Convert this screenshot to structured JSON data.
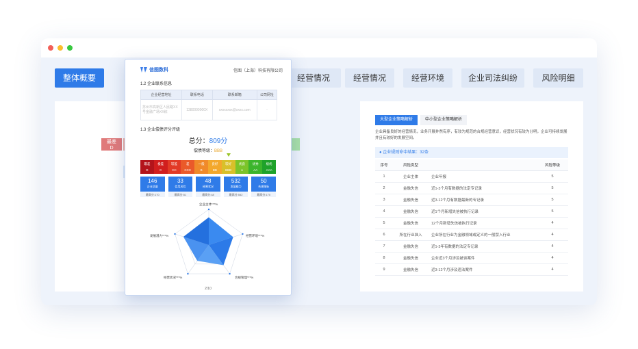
{
  "window": {
    "dots": [
      "#f25f58",
      "#fbbe2e",
      "#39c840"
    ]
  },
  "tabs": [
    {
      "label": "整体概要",
      "active": true
    },
    {
      "label": "经营情况"
    },
    {
      "label": "经营情况"
    },
    {
      "label": "经营环境"
    },
    {
      "label": "企业司法纠纷"
    },
    {
      "label": "风险明细"
    }
  ],
  "left_tags": [
    {
      "l1": "最差",
      "l2": "D"
    }
  ],
  "doc": {
    "brand": "信图数科",
    "company": "信图（上海）科技有限公司",
    "sec12": "1.2   企业联系信息",
    "contact_headers": [
      "企业经营地址",
      "联系电话",
      "联系邮箱",
      "公司网址"
    ],
    "contact_row": [
      "苏州市高新区人民路XX号金融广场XX栋",
      "1380000000X",
      "xxxxxxxx@xxxx.com",
      "-"
    ],
    "sec13": "1.3   企业偿债评分评级",
    "score_label": "总分：",
    "score_value": "809分",
    "grade_label": "偿债等级：",
    "grade_value": "BBB",
    "levels": [
      {
        "t": "最差",
        "v": "D",
        "c": "#b3141b"
      },
      {
        "t": "极差",
        "v": "C",
        "c": "#d11e1e"
      },
      {
        "t": "较差",
        "v": "CC",
        "c": "#e23a26"
      },
      {
        "t": "差",
        "v": "CCC",
        "c": "#ea5a2a"
      },
      {
        "t": "一般",
        "v": "B",
        "c": "#f08a2a"
      },
      {
        "t": "良好",
        "v": "BB",
        "c": "#f3a82c"
      },
      {
        "t": "较好",
        "v": "BBB",
        "c": "#d9c02a"
      },
      {
        "t": "优良",
        "v": "A",
        "c": "#7cc42a"
      },
      {
        "t": "优秀",
        "v": "AA",
        "c": "#3cb52c"
      },
      {
        "t": "极优",
        "v": "AAA",
        "c": "#1ea22a"
      }
    ],
    "stats": [
      {
        "n": "146",
        "l": "企业总量",
        "s": "最高分:170"
      },
      {
        "n": "33",
        "l": "信用风险",
        "s": "最高分:51"
      },
      {
        "n": "48",
        "l": "经营状况",
        "s": "最高分:48"
      },
      {
        "n": "532",
        "l": "发展能力",
        "s": "最高分:552"
      },
      {
        "n": "50",
        "l": "合规指标",
        "s": "最高分:170"
      }
    ],
    "radar": {
      "labels": [
        "企业主体***%",
        "经营环境***%",
        "合规管理***%",
        "经营状况***%",
        "发展潜力***%"
      ],
      "values": [
        0.78,
        0.72,
        0.7,
        0.55,
        0.75
      ]
    },
    "page": "2/10"
  },
  "right": {
    "tabs": [
      {
        "label": "大型企业策略解析",
        "active": true
      },
      {
        "label": "中小型企业策略解析"
      }
    ],
    "desc": "企业具备良好的经营情况，业务开展井然有序，有较为规范的合规经营意识，经营状况有较为分明，企业可持续发展并且有较好的发展空间。",
    "risk_title": "企业规则命中结果：32条",
    "headers": [
      "序号",
      "风险类型",
      "",
      "风险等级"
    ],
    "rows": [
      [
        "1",
        "企业主体",
        "企业年报",
        "5"
      ],
      [
        "2",
        "金融失信",
        "近1-3个月有数据的法定专记录",
        "5"
      ],
      [
        "3",
        "金融失信",
        "近3-12个月有数据最新的专记录",
        "5"
      ],
      [
        "4",
        "金融失信",
        "近1个月新增失信被执行记录",
        "5"
      ],
      [
        "5",
        "金融失信",
        "12个月新增失信被执行记录",
        "4"
      ],
      [
        "6",
        "所在行业准入",
        "企业所在行业为金融领域或定义的一般禁入行业",
        "4"
      ],
      [
        "7",
        "金融失信",
        "近1-3年有数据的法定专记录",
        "4"
      ],
      [
        "8",
        "金融失信",
        "企业近3个月涉及被诉案件",
        "4"
      ],
      [
        "9",
        "金融失信",
        "近3-12个月涉及违法案件",
        "4"
      ]
    ]
  }
}
